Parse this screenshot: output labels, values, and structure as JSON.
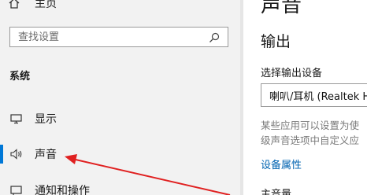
{
  "sidebar": {
    "home_label": "主页",
    "search": {
      "placeholder": "查找设置"
    },
    "section_title": "系统",
    "items": [
      {
        "label": "显示",
        "icon": "monitor-icon"
      },
      {
        "label": "声音",
        "icon": "speaker-icon",
        "active": true
      },
      {
        "label": "通知和操作",
        "icon": "notification-icon"
      }
    ]
  },
  "main": {
    "title": "声音",
    "output_heading": "输出",
    "select_device_label": "选择输出设备",
    "device_value": "喇叭/耳机 (Realtek H",
    "description_line1": "某些应用可以设置为使",
    "description_line2": "级声音选项中自定义应",
    "device_properties_link": "设备属性",
    "master_volume_label": "主音量"
  },
  "colors": {
    "accent": "#0078d7",
    "link": "#0063b1",
    "annotation_arrow": "#e02020"
  }
}
